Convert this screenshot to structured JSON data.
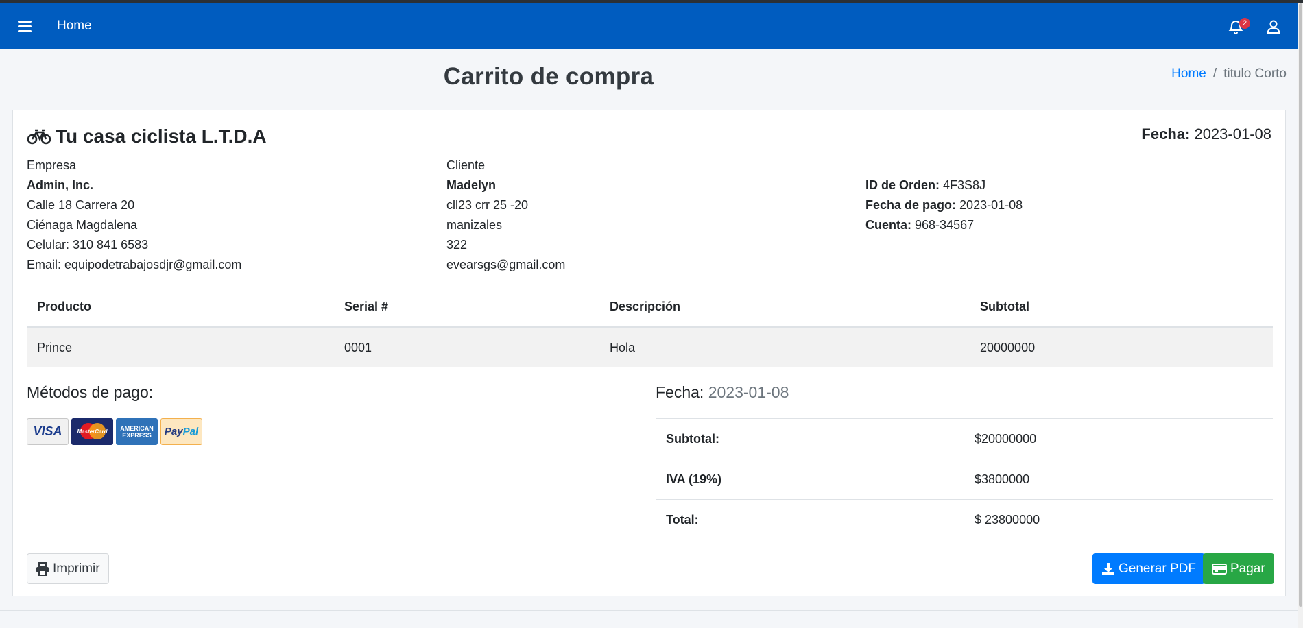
{
  "navbar": {
    "home_label": "Home",
    "notification_count": "2",
    "color": "#005cbf"
  },
  "page": {
    "title": "Carrito de compra"
  },
  "breadcrumb": {
    "home": "Home",
    "separator": "/",
    "current": "titulo Corto"
  },
  "invoice": {
    "company_name": "Tu casa ciclista L.T.D.A",
    "date_label": "Fecha:",
    "date_value": "2023-01-08",
    "from": {
      "heading": "Empresa",
      "name": "Admin, Inc.",
      "address": "Calle 18 Carrera 20",
      "city": "Ciénaga Magdalena",
      "phone": "Celular: 310 841 6583",
      "email": "Email: equipodetrabajosdjr@gmail.com"
    },
    "to": {
      "heading": "Cliente",
      "name": "Madelyn",
      "address": "cll23 crr 25 -20",
      "city": "manizales",
      "phone": "322",
      "email": "evearsgs@gmail.com"
    },
    "order": {
      "id_label": "ID de Orden:",
      "id_value": "4F3S8J",
      "payment_date_label": "Fecha de pago:",
      "payment_date_value": "2023-01-08",
      "account_label": "Cuenta:",
      "account_value": "968-34567"
    },
    "items_table": {
      "headers": [
        "Producto",
        "Serial #",
        "Descripción",
        "Subtotal"
      ],
      "rows": [
        [
          "Prince",
          "0001",
          "Hola",
          "20000000"
        ]
      ]
    },
    "payment_methods_title": "Métodos de pago:",
    "payment_methods": [
      "visa-card-icon",
      "mastercard-icon",
      "american-express-icon",
      "paypal-icon"
    ],
    "card_text": {
      "visa": "VISA",
      "mastercard": "MasterCard",
      "amex_line1": "AMERICAN",
      "amex_line2": "EXPRESS",
      "paypal_pay": "Pay",
      "paypal_pal": "Pal"
    },
    "summary": {
      "title_label": "Fecha:",
      "title_value": "2023-01-08",
      "subtotal_label": "Subtotal:",
      "subtotal_value": "$20000000",
      "tax_label": "IVA (19%)",
      "tax_value": "$3800000",
      "total_label": "Total:",
      "total_value": "$ 23800000"
    },
    "buttons": {
      "print": "Imprimir",
      "pdf": "Generar PDF",
      "pay": "Pagar"
    }
  },
  "colors": {
    "primary": "#007bff",
    "success": "#28a745",
    "danger": "#dc3545"
  }
}
